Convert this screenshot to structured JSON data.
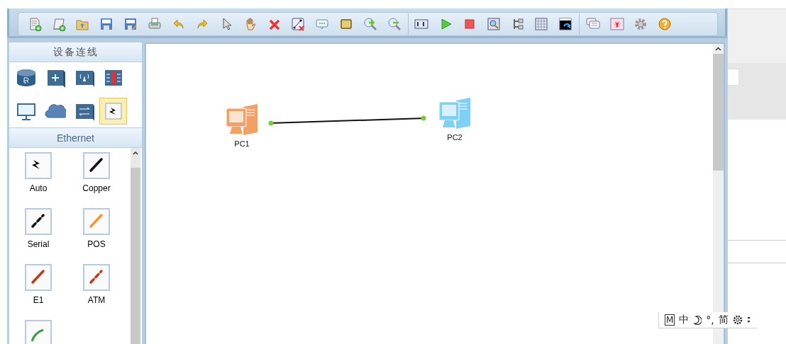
{
  "device_panel": {
    "title": "设备连线",
    "categories": [
      {
        "kind": "router",
        "selected": false
      },
      {
        "kind": "switch",
        "selected": false
      },
      {
        "kind": "wireless",
        "selected": false
      },
      {
        "kind": "firewall",
        "selected": false
      },
      {
        "kind": "pc",
        "selected": false
      },
      {
        "kind": "cloud",
        "selected": false
      },
      {
        "kind": "hub",
        "selected": false
      },
      {
        "kind": "cable",
        "selected": true
      }
    ]
  },
  "cable_panel": {
    "title": "Ethernet",
    "cables": [
      {
        "kind": "auto",
        "label": "Auto"
      },
      {
        "kind": "line",
        "label": "Copper",
        "color": "#111111",
        "dashed": false
      },
      {
        "kind": "line",
        "label": "Serial",
        "color": "#111111",
        "dashed": true
      },
      {
        "kind": "line",
        "label": "POS",
        "color": "#f7962f",
        "dashed": false
      },
      {
        "kind": "line",
        "label": "E1",
        "color": "#c0391b",
        "dashed": false
      },
      {
        "kind": "line",
        "label": "ATM",
        "color": "#c0391b",
        "dashed": true
      },
      {
        "kind": "curve",
        "color": "#3f9a48"
      }
    ]
  },
  "topology": {
    "nodes": [
      {
        "label": "PC1",
        "color": "#f2a066"
      },
      {
        "label": "PC2",
        "color": "#7fd0f7"
      }
    ],
    "links": [
      {
        "up": true
      }
    ]
  },
  "ime_bar": {
    "items": [
      {
        "kind": "boxed",
        "text": "M"
      },
      {
        "kind": "text",
        "text": "中"
      },
      {
        "kind": "moon"
      },
      {
        "kind": "text",
        "text": "°,"
      },
      {
        "kind": "text",
        "text": "简"
      },
      {
        "kind": "gear"
      },
      {
        "kind": "more"
      }
    ]
  }
}
